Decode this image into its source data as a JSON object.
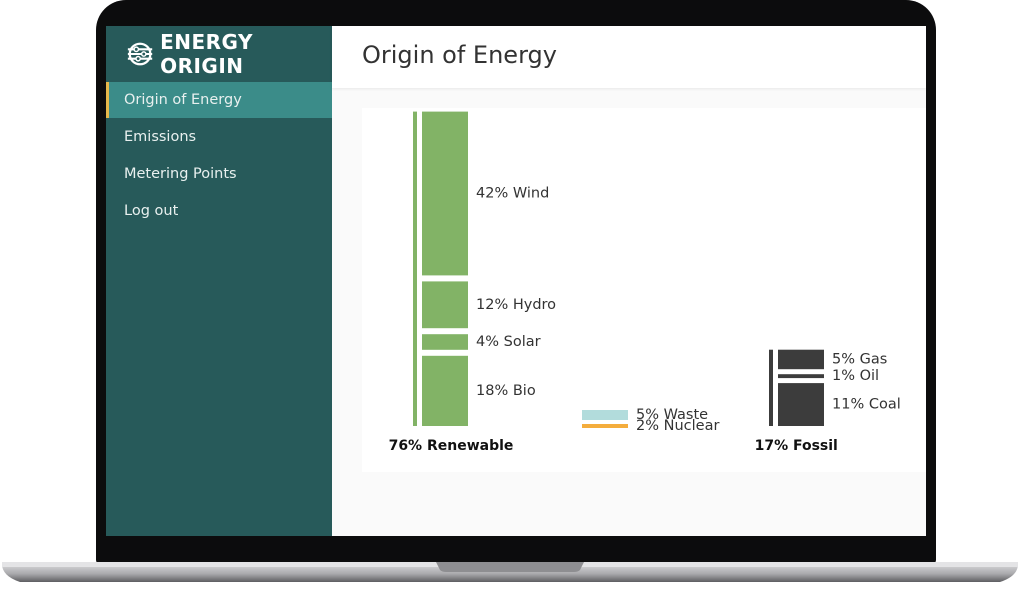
{
  "brand": {
    "name": "ENERGY ORIGIN",
    "icon": "globe-logo-icon"
  },
  "sidebar": {
    "items": [
      {
        "label": "Origin of Energy",
        "active": true
      },
      {
        "label": "Emissions",
        "active": false
      },
      {
        "label": "Metering Points",
        "active": false
      },
      {
        "label": "Log out",
        "active": false
      }
    ]
  },
  "header": {
    "title": "Origin of Energy"
  },
  "colors": {
    "sidebar": "#275a5a",
    "active_item": "#3b8c89",
    "accent": "#e5b84c",
    "renewable": "#82b366",
    "waste": "#b2dcdc",
    "nuclear": "#f4ad3d",
    "fossil": "#3c3c3c"
  },
  "chart_data": {
    "type": "bar",
    "groups": [
      {
        "name": "76% Renewable",
        "total": 76,
        "segments": [
          {
            "label": "42% Wind",
            "value": 42
          },
          {
            "label": "12% Hydro",
            "value": 12
          },
          {
            "label": "4% Solar",
            "value": 4
          },
          {
            "label": "18% Bio",
            "value": 18
          }
        ]
      },
      {
        "name": "",
        "total": 7,
        "segments": [
          {
            "label": "5% Waste",
            "value": 5
          },
          {
            "label": "2% Nuclear",
            "value": 2
          }
        ]
      },
      {
        "name": "17% Fossil",
        "total": 17,
        "segments": [
          {
            "label": "5% Gas",
            "value": 5
          },
          {
            "label": "1% Oil",
            "value": 1
          },
          {
            "label": "11% Coal",
            "value": 11
          }
        ]
      }
    ]
  }
}
